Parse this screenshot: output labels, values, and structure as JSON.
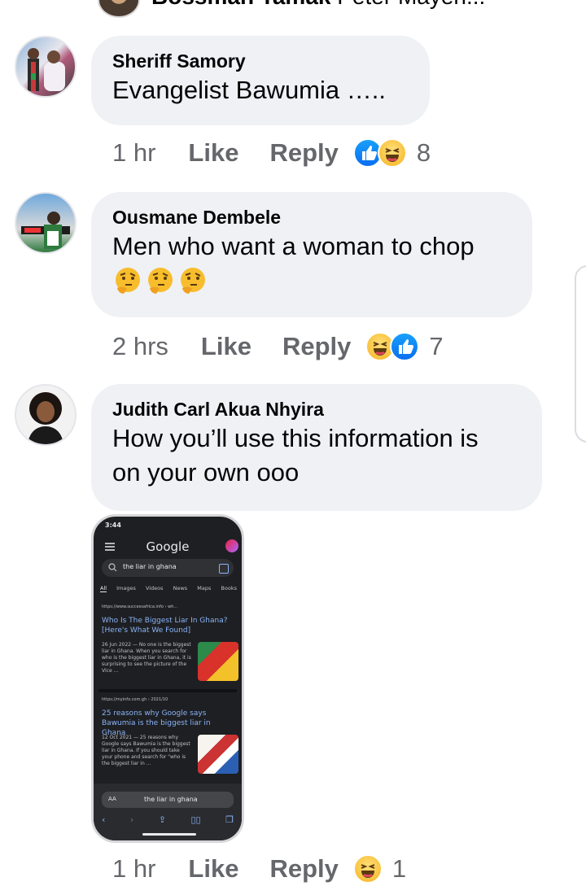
{
  "top": {
    "name": "Bossman Tamak",
    "preview": "Peter Mayeh..."
  },
  "comments": [
    {
      "author": "Sheriff Samory",
      "text": "Evangelist Bawumia …..",
      "time": "1 hr",
      "like_label": "Like",
      "reply_label": "Reply",
      "reaction_count": "8"
    },
    {
      "author": "Ousmane Dembele",
      "text": "Men who want a woman to chop",
      "emojis": [
        "thinking-face",
        "thinking-face",
        "thinking-face"
      ],
      "avatar_badge": "ENDSARS",
      "time": "2 hrs",
      "like_label": "Like",
      "reply_label": "Reply",
      "reaction_count": "7"
    },
    {
      "author": "Judith Carl Akua Nhyira",
      "text_line1": "How you’ll use this information is",
      "text_line2": "on your own ooo",
      "time": "1 hr",
      "like_label": "Like",
      "reply_label": "Reply",
      "reaction_count": "1"
    }
  ],
  "phone_screenshot": {
    "status_time": "3:44",
    "brand": "Google",
    "search_query": "the liar in ghana",
    "tabs": [
      "All",
      "Images",
      "Videos",
      "News",
      "Maps",
      "Books"
    ],
    "results": [
      {
        "url": "https://www.successafrica.info › wh...",
        "title": "Who Is The Biggest Liar In Ghana? [Here's What We Found]",
        "snippet": "26 Jun 2022 — No one is the biggest liar in Ghana. When you search for who is the biggest liar in Ghana, it is surprising to see the picture of the Vice ..."
      },
      {
        "url": "https://myinfo.com.gh › 2021/10",
        "title": "25 reasons why Google says Bawumia is the biggest liar in Ghana",
        "snippet": "12 Oct 2021 — 25 reasons why Google says Bawumia is the biggest liar in Ghana. If you should take your phone and search for \"who is the biggest liar in ..."
      }
    ],
    "address_bar": "the liar in ghana",
    "address_aa": "AA"
  },
  "colors": {
    "bubble": "#eff1f5",
    "meta_text": "#65676b",
    "like_blue": "#0a6ef0"
  }
}
